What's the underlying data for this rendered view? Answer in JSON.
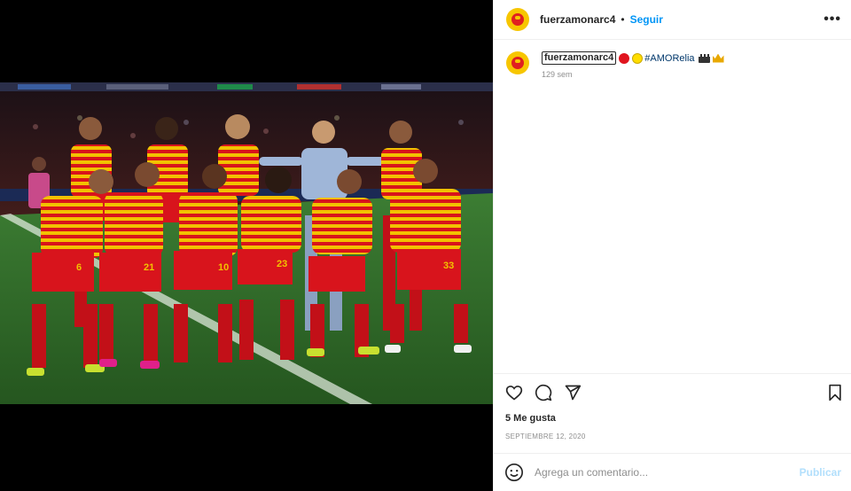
{
  "post": {
    "username": "fuerzamonarc4",
    "separator": "•",
    "follow_label": "Seguir",
    "more_label": "•••",
    "caption": {
      "username": "fuerzamonarc4",
      "hashtag": "#AMORelia",
      "time": "129 sem"
    },
    "likes": "5 Me gusta",
    "date": "SEPTIEMBRE 12, 2020",
    "comment_placeholder": "Agrega un comentario...",
    "publish_label": "Publicar"
  },
  "photo": {
    "description_icon": "team-photo",
    "kit_colors": {
      "red": "#d8141c",
      "yellow": "#f2c200",
      "pitch": "#2f6b2a"
    },
    "shirt_numbers": [
      "6",
      "21",
      "10",
      "23",
      "33"
    ]
  }
}
